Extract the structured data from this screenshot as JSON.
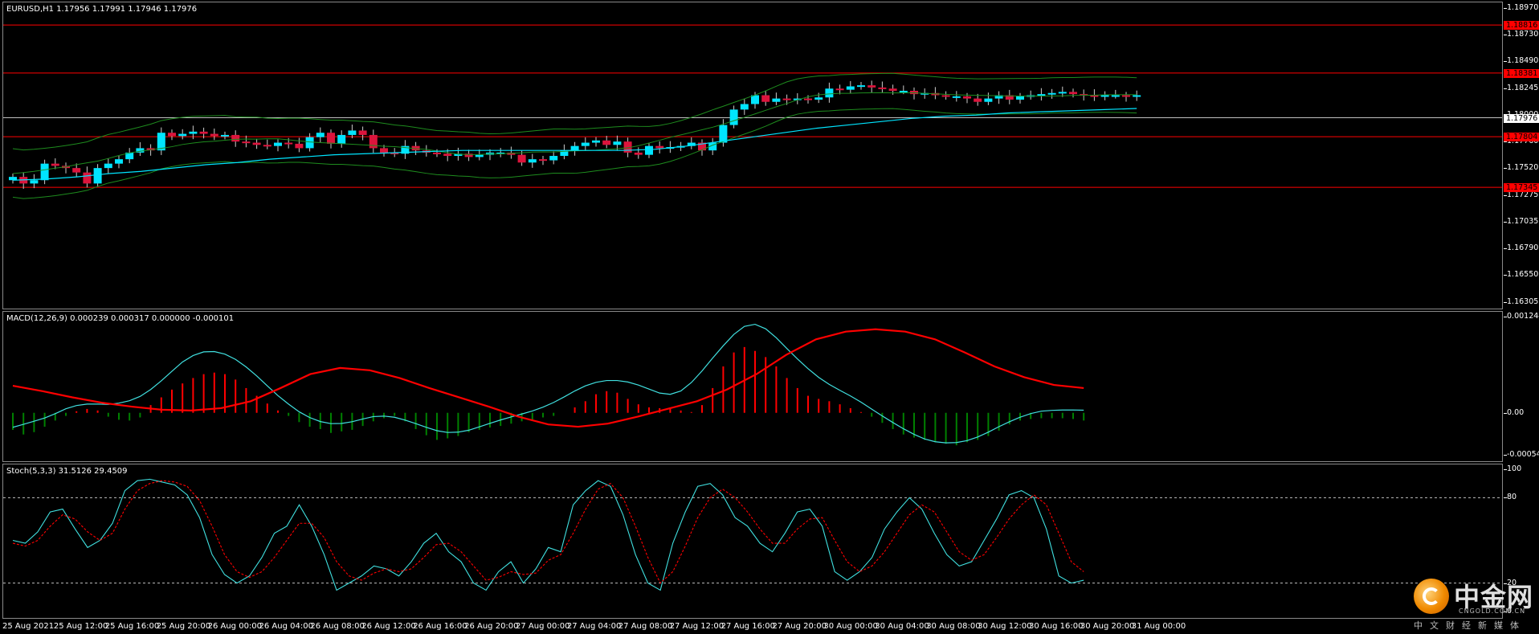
{
  "main": {
    "label": "EURUSD,H1  1.17956 1.17991 1.17946 1.17976",
    "price_ticks": [
      "1.18970",
      "1.18730",
      "1.18490",
      "1.18245",
      "1.18000",
      "1.17760",
      "1.17520",
      "1.17275",
      "1.17035",
      "1.16790",
      "1.16550",
      "1.16305"
    ],
    "current_price": "1.17976",
    "red_levels": [
      "1.18816",
      "1.18381",
      "1.17804",
      "1.17345"
    ]
  },
  "macd": {
    "label": "MACD(12,26,9) 0.000239 0.000317 0.000000 -0.000101",
    "ticks": [
      "0.001244",
      "0.00",
      "-0.000543"
    ]
  },
  "stoch": {
    "label": "Stoch(5,3,3) 31.5126 29.4509",
    "ticks": [
      "100",
      "80",
      "20",
      "0"
    ]
  },
  "time_axis": [
    "25 Aug 2021",
    "25 Aug 12:00",
    "25 Aug 16:00",
    "25 Aug 20:00",
    "26 Aug 00:00",
    "26 Aug 04:00",
    "26 Aug 08:00",
    "26 Aug 12:00",
    "26 Aug 16:00",
    "26 Aug 20:00",
    "27 Aug 00:00",
    "27 Aug 04:00",
    "27 Aug 08:00",
    "27 Aug 12:00",
    "27 Aug 16:00",
    "27 Aug 20:00",
    "30 Aug 00:00",
    "30 Aug 04:00",
    "30 Aug 08:00",
    "30 Aug 12:00",
    "30 Aug 16:00",
    "30 Aug 20:00",
    "31 Aug 00:00"
  ],
  "colors": {
    "bull": "#00e5ff",
    "bear": "#dc143c",
    "ma": "#00e5ff",
    "bands": "#1e8c1e",
    "level": "#ff0000",
    "macd_pos": "#ff0000",
    "macd_neg": "#008000",
    "signal": "#ff0000",
    "macd_line": "#40e0e0",
    "stoch_main": "#40e0e0",
    "stoch_signal": "#ff0000"
  },
  "logo": {
    "name": "中金网",
    "domain": "CNGOLD.COM.CN",
    "sub": "中文财经新媒体"
  },
  "chart_data": [
    {
      "type": "candlestick",
      "title": "EURUSD,H1",
      "ylim": [
        1.16305,
        1.1897
      ],
      "series": [
        {
          "name": "close",
          "values": [
            1.1744,
            1.1738,
            1.1741,
            1.1756,
            1.1754,
            1.1752,
            1.1748,
            1.1738,
            1.1752,
            1.1756,
            1.176,
            1.1766,
            1.177,
            1.1768,
            1.1784,
            1.1781,
            1.1783,
            1.1785,
            1.1783,
            1.1781,
            1.1782,
            1.1776,
            1.1775,
            1.1773,
            1.1772,
            1.1775,
            1.1774,
            1.177,
            1.178,
            1.1784,
            1.1774,
            1.1782,
            1.1786,
            1.1782,
            1.177,
            1.1766,
            1.1765,
            1.1772,
            1.1768,
            1.1766,
            1.1765,
            1.1763,
            1.1765,
            1.1762,
            1.1764,
            1.1766,
            1.1766,
            1.1764,
            1.1757,
            1.176,
            1.1759,
            1.1763,
            1.1768,
            1.1772,
            1.1775,
            1.1777,
            1.1773,
            1.1776,
            1.1766,
            1.1764,
            1.1772,
            1.177,
            1.1771,
            1.1772,
            1.1775,
            1.1768,
            1.1775,
            1.1791,
            1.1805,
            1.181,
            1.1818,
            1.1812,
            1.1815,
            1.1814,
            1.1815,
            1.1814,
            1.1816,
            1.1824,
            1.1823,
            1.1826,
            1.1827,
            1.1825,
            1.1824,
            1.1822,
            1.1822,
            1.1819,
            1.182,
            1.1818,
            1.1817,
            1.1817,
            1.1815,
            1.1812,
            1.1815,
            1.1818,
            1.1814,
            1.1817,
            1.1818,
            1.1819,
            1.182,
            1.1821,
            1.1819,
            1.1818,
            1.1817,
            1.1818,
            1.1818,
            1.1817,
            1.1818
          ]
        },
        {
          "name": "MA",
          "values": [
            1.1741,
            1.1742,
            1.1744,
            1.1747,
            1.1749,
            1.1752,
            1.1755,
            1.1757,
            1.176,
            1.1762,
            1.1764,
            1.1765,
            1.1766,
            1.1767,
            1.1768,
            1.1768,
            1.1768,
            1.1768,
            1.1768,
            1.1768,
            1.1769,
            1.1772,
            1.1776,
            1.178,
            1.1784,
            1.1788,
            1.1791,
            1.1794,
            1.1797,
            1.1799,
            1.18,
            1.1802,
            1.1803,
            1.1804,
            1.1805,
            1.1806
          ]
        }
      ],
      "levels": [
        1.18816,
        1.18381,
        1.17804,
        1.17345
      ],
      "current": 1.17976
    },
    {
      "type": "bar",
      "title": "MACD(12,26,9)",
      "ylim": [
        -0.000543,
        0.001244
      ],
      "values": [
        -0.00022,
        -0.00028,
        -0.00025,
        -0.00018,
        -0.0001,
        -4e-05,
        2e-05,
        5e-05,
        3e-05,
        -5e-05,
        -9e-05,
        -0.0001,
        -6e-05,
        0.0001,
        0.0002,
        0.0003,
        0.00038,
        0.00045,
        0.0005,
        0.00052,
        0.0005,
        0.00043,
        0.00032,
        0.00022,
        0.00012,
        3e-05,
        -4e-05,
        -0.00012,
        -0.00018,
        -0.00021,
        -0.00026,
        -0.00024,
        -0.00022,
        -0.00017,
        -0.00011,
        -7e-05,
        -4e-05,
        -0.00011,
        -0.00021,
        -0.00029,
        -0.00035,
        -0.00033,
        -0.0003,
        -0.00025,
        -0.00022,
        -0.00019,
        -0.00017,
        -0.00014,
        -0.00011,
        -9e-05,
        -6e-05,
        -4e-05,
        0,
        7e-05,
        0.00015,
        0.00024,
        0.00028,
        0.00026,
        0.00018,
        0.00011,
        7e-05,
        6e-05,
        5e-05,
        3e-05,
        1e-05,
        0.0001,
        0.00032,
        0.0006,
        0.00078,
        0.00085,
        0.0008,
        0.00072,
        0.0006,
        0.00045,
        0.00032,
        0.00022,
        0.00018,
        0.00015,
        0.00011,
        6e-05,
        1e-05,
        -5e-05,
        -0.00013,
        -0.00021,
        -0.00028,
        -0.00032,
        -0.00035,
        -0.00038,
        -0.0004,
        -0.00042,
        -0.00038,
        -0.00035,
        -0.0003,
        -0.00023,
        -0.00015,
        -0.0001,
        -8e-05,
        -7e-05,
        -7e-05,
        -7e-05,
        -8e-05,
        -0.0001
      ],
      "signal": [
        0.00035,
        0.00028,
        0.0002,
        0.00013,
        8e-05,
        4e-05,
        3e-05,
        6e-05,
        0.00015,
        0.00032,
        0.0005,
        0.00058,
        0.00055,
        0.00045,
        0.00032,
        0.0002,
        8e-05,
        -5e-05,
        -0.00015,
        -0.00018,
        -0.00014,
        -5e-05,
        5e-05,
        0.00015,
        0.0003,
        0.0005,
        0.00075,
        0.00095,
        0.00105,
        0.00108,
        0.00105,
        0.00095,
        0.00078,
        0.0006,
        0.00046,
        0.00036,
        0.00032
      ]
    },
    {
      "type": "line",
      "title": "Stoch(5,3,3)",
      "ylim": [
        0,
        100
      ],
      "series": [
        {
          "name": "main",
          "values": [
            50,
            48,
            56,
            70,
            72,
            58,
            45,
            50,
            62,
            85,
            92,
            93,
            91,
            89,
            82,
            66,
            40,
            26,
            20,
            25,
            38,
            55,
            60,
            75,
            60,
            40,
            15,
            20,
            25,
            32,
            30,
            25,
            35,
            48,
            55,
            42,
            35,
            20,
            15,
            28,
            35,
            20,
            30,
            45,
            42,
            75,
            85,
            92,
            88,
            68,
            40,
            20,
            15,
            48,
            70,
            88,
            90,
            82,
            66,
            60,
            48,
            42,
            55,
            70,
            72,
            60,
            28,
            22,
            28,
            38,
            58,
            70,
            80,
            72,
            55,
            40,
            32,
            35,
            50,
            65,
            82,
            85,
            80,
            58,
            25,
            20,
            22
          ]
        },
        {
          "name": "signal",
          "values": [
            48,
            46,
            50,
            60,
            68,
            65,
            56,
            50,
            55,
            72,
            85,
            90,
            92,
            91,
            88,
            78,
            60,
            40,
            28,
            24,
            28,
            38,
            50,
            62,
            62,
            52,
            35,
            25,
            22,
            27,
            30,
            28,
            30,
            38,
            47,
            48,
            42,
            32,
            22,
            24,
            28,
            26,
            27,
            36,
            40,
            55,
            72,
            86,
            90,
            80,
            60,
            38,
            20,
            28,
            46,
            66,
            80,
            86,
            80,
            70,
            58,
            48,
            48,
            58,
            65,
            66,
            50,
            35,
            28,
            32,
            42,
            55,
            68,
            75,
            70,
            56,
            42,
            36,
            40,
            52,
            65,
            75,
            82,
            75,
            55,
            35,
            28
          ]
        }
      ],
      "levels": [
        80,
        20
      ]
    }
  ]
}
